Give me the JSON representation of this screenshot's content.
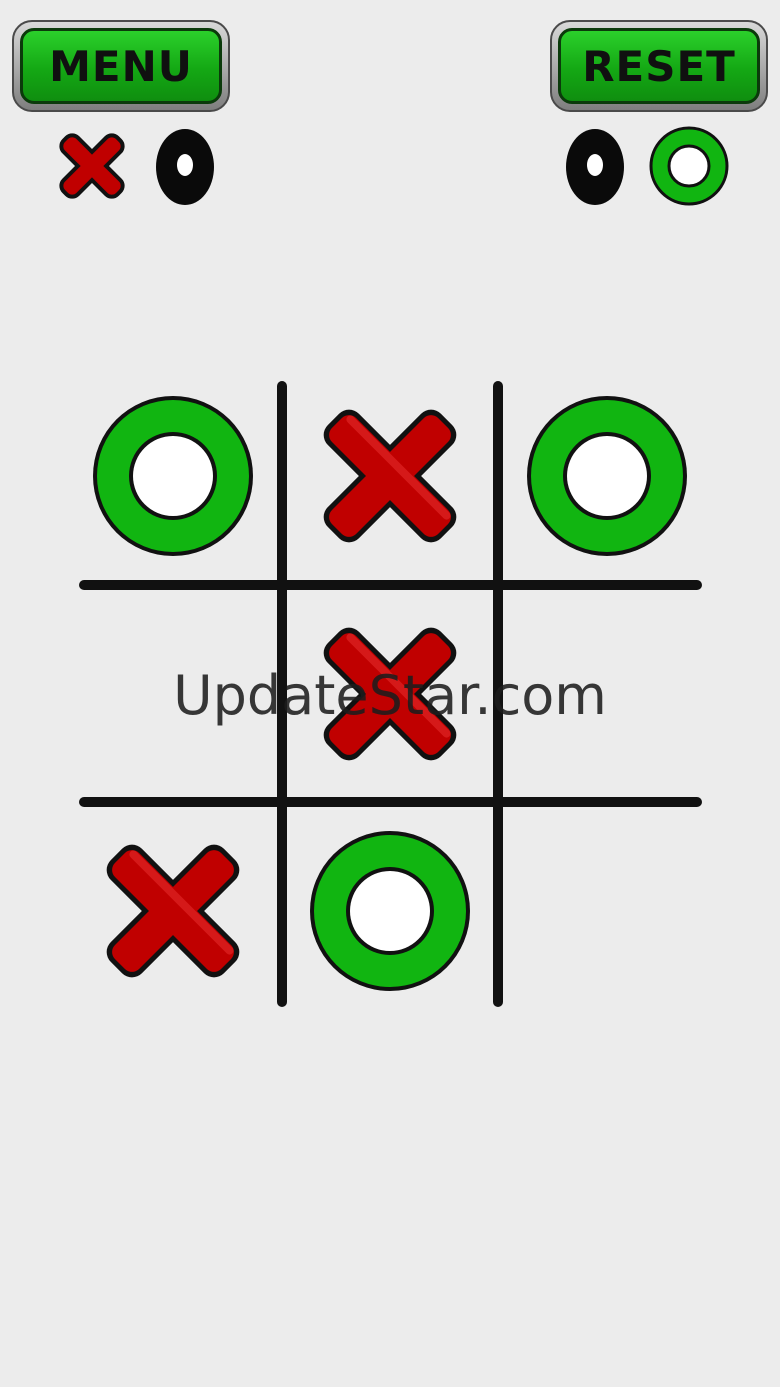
{
  "header": {
    "menu_label": "MENU",
    "reset_label": "RESET"
  },
  "turn_indicators": {
    "left": [
      "x-mark-red",
      "o-mark-black"
    ],
    "right": [
      "o-mark-black",
      "o-mark-green"
    ]
  },
  "board": {
    "cells": [
      [
        "O",
        "X",
        "O"
      ],
      [
        "",
        "X",
        ""
      ],
      [
        "X",
        "O",
        ""
      ]
    ]
  },
  "watermark": {
    "text": "UpdateStar.com"
  },
  "colors": {
    "background": "#ececec",
    "button_green": "#14a814",
    "x_red": "#c00000",
    "o_green": "#11b511",
    "grid_line": "#111111"
  }
}
